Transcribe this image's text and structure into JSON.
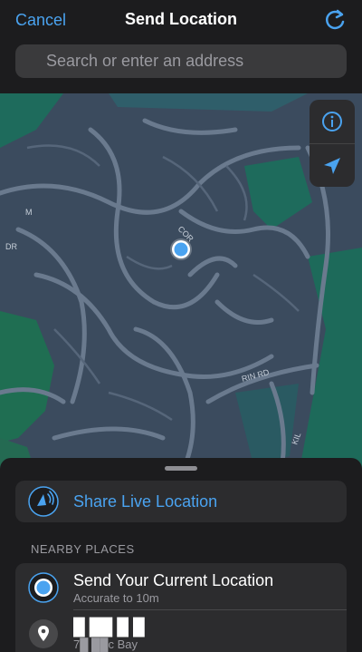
{
  "header": {
    "cancel_label": "Cancel",
    "title": "Send Location",
    "refresh_icon": "refresh-icon"
  },
  "search": {
    "placeholder": "Search or enter an address"
  },
  "map": {
    "street_labels": [
      "DR",
      "COR",
      "RIN RD",
      "KIL",
      "M"
    ],
    "controls": {
      "info_icon": "info-icon",
      "location_icon": "location-arrow-icon"
    }
  },
  "sheet": {
    "share_live_label": "Share Live Location",
    "nearby_header": "NEARBY PLACES",
    "places": [
      {
        "title": "Send Your Current Location",
        "subtitle": "Accurate to 10m",
        "icon": "current-location-icon"
      },
      {
        "title": "█ ██ █ █",
        "subtitle": "7█ ██c Bay",
        "icon": "map-pin-icon"
      }
    ]
  },
  "colors": {
    "accent": "#4aa3f0",
    "background": "#1c1c1e",
    "map_base": "#3a4a5c",
    "map_green": "#1e6b5c"
  }
}
